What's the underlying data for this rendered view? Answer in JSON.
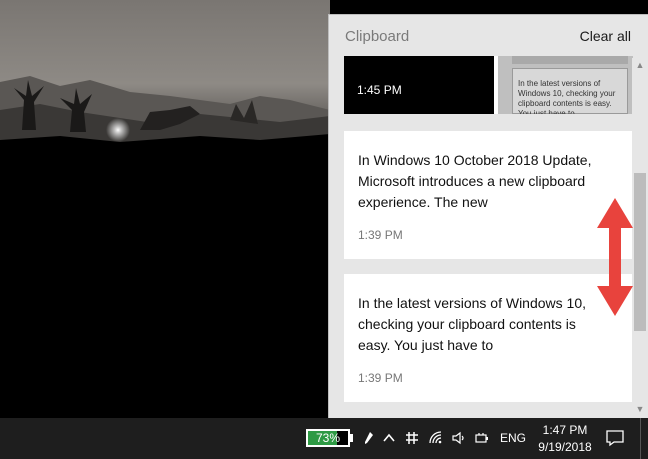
{
  "clipboard": {
    "title": "Clipboard",
    "clear_all": "Clear all",
    "items": [
      {
        "type": "image",
        "time": "1:45 PM",
        "thumbnail_text": "In the latest versions of Windows 10, checking your clipboard contents is easy. You just have to"
      },
      {
        "type": "text",
        "content": "In Windows 10 October 2018 Update, Microsoft introduces a new clipboard experience. The new",
        "time": "1:39 PM"
      },
      {
        "type": "text",
        "content": "In the latest versions of Windows 10, checking your clipboard contents is easy. You just have to",
        "time": "1:39 PM"
      }
    ]
  },
  "taskbar": {
    "battery_percent_label": "73%",
    "battery_level": 0.73,
    "language": "ENG",
    "clock_time": "1:47 PM",
    "clock_date": "9/19/2018",
    "tray_icons": [
      "pen-icon",
      "chevron-up-icon",
      "network-hub-icon",
      "wifi-icon",
      "volume-icon",
      "power-plug-icon"
    ]
  },
  "colors": {
    "battery_fill": "#2e9a44",
    "drag_arrow": "#e8433d"
  }
}
